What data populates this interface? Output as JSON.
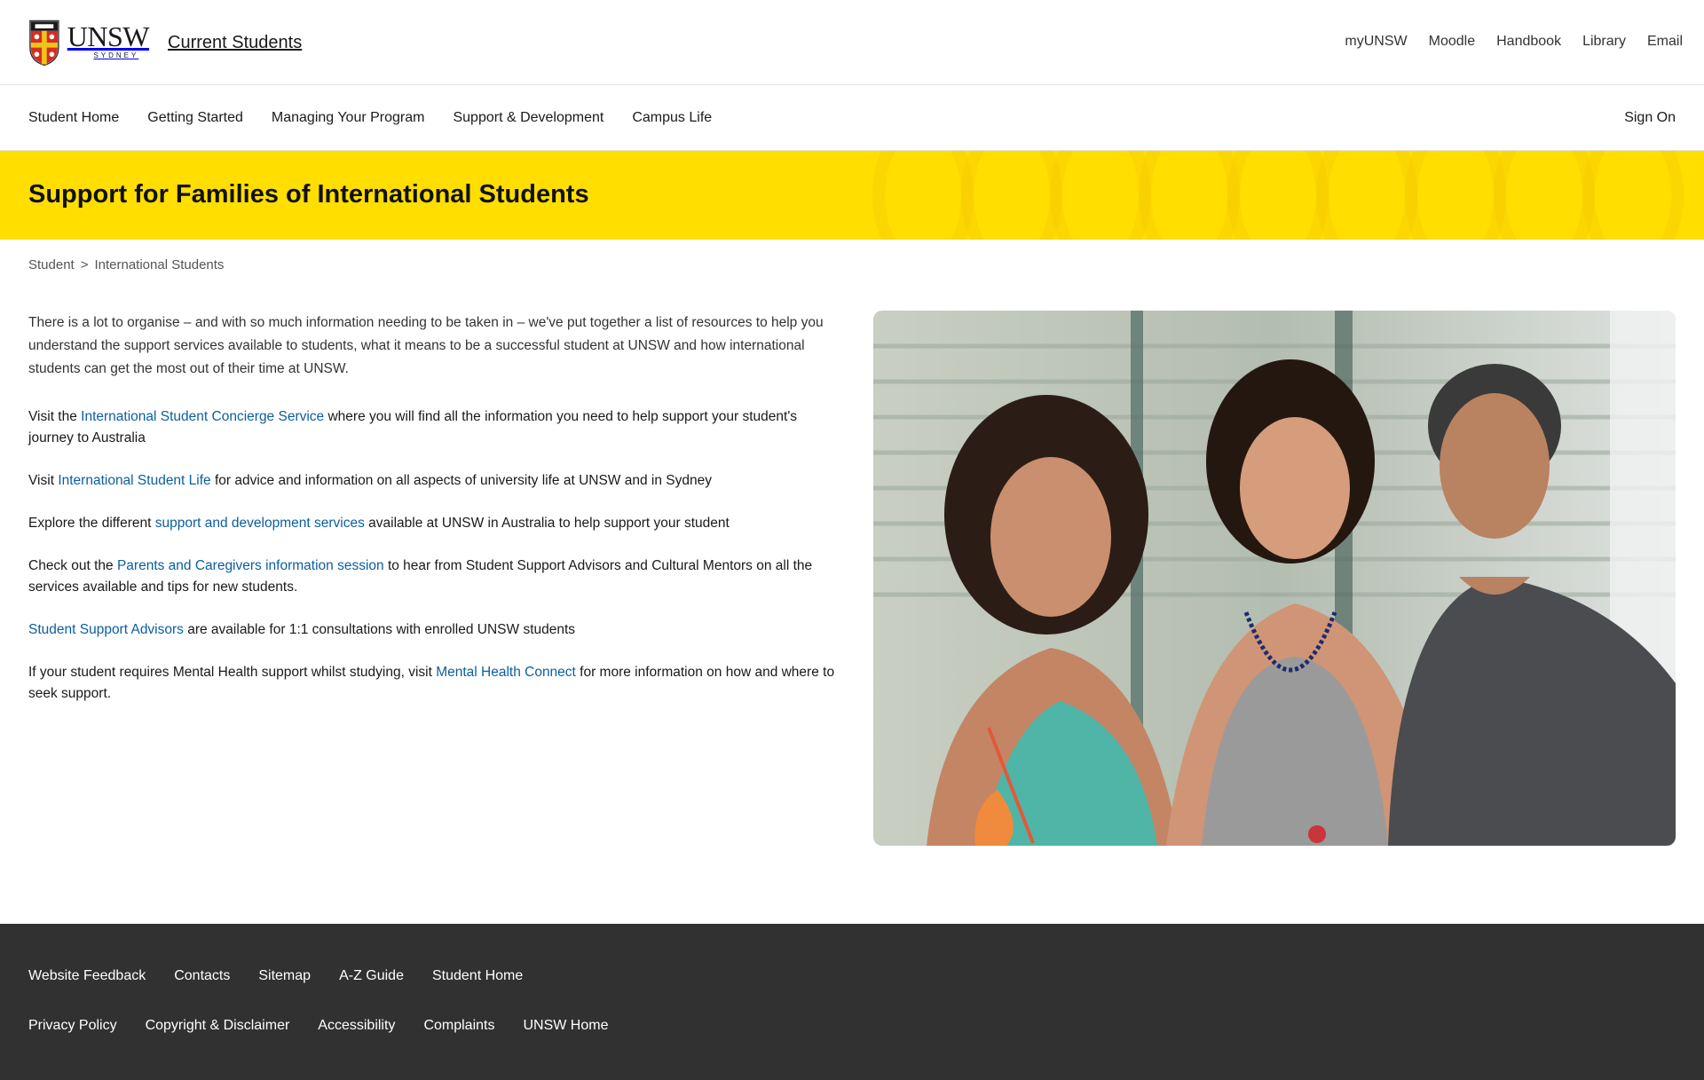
{
  "header": {
    "logo_text": "UNSW",
    "logo_subtext": "SYDNEY",
    "site_title": "Current Students",
    "utility_links": [
      "myUNSW",
      "Moodle",
      "Handbook",
      "Library",
      "Email"
    ]
  },
  "nav": {
    "items": [
      "Student Home",
      "Getting Started",
      "Managing Your Program",
      "Support & Development",
      "Campus Life"
    ],
    "sign_on": "Sign On"
  },
  "banner": {
    "title": "Support for Families of International Students",
    "color": "#ffde00"
  },
  "breadcrumb": {
    "items": [
      "Student",
      "International Students"
    ],
    "separator": ">"
  },
  "content": {
    "intro": "There is a lot to organise – and with so much information needing to be taken in – we've put together a list of resources to help you understand the support services available to students, what it means to be a successful student at UNSW and how international students can get the most out of their time at UNSW.",
    "p1": {
      "before": "Visit the ",
      "link": "International Student Concierge Service",
      "after": " where you will find all the information you need to help support your student's journey to Australia"
    },
    "p2": {
      "before": "Visit ",
      "link": "International Student Life",
      "after": " for advice and information on all aspects of university life at UNSW and in Sydney"
    },
    "p3": {
      "before": "Explore the different ",
      "link": "support and development services",
      "after": " available at UNSW in Australia to help support your student"
    },
    "p4": {
      "before": "Check out the ",
      "link": "Parents and Caregivers information session",
      "after": " to hear from Student Support Advisors and Cultural Mentors on all the services available and tips for new students."
    },
    "p5": {
      "link": "Student Support Advisors",
      "after": " are available for 1:1 consultations with enrolled UNSW students"
    },
    "p6": {
      "before": "If your student requires Mental Health support whilst studying, visit ",
      "link": "Mental Health Connect",
      "after": " for more information on how and where to seek support."
    },
    "link_color": "#0b5e9e"
  },
  "footer": {
    "row1": [
      "Website Feedback",
      "Contacts",
      "Sitemap",
      "A-Z Guide",
      "Student Home"
    ],
    "row2": [
      "Privacy Policy",
      "Copyright & Disclaimer",
      "Accessibility",
      "Complaints",
      "UNSW Home"
    ],
    "background": "#313131"
  }
}
